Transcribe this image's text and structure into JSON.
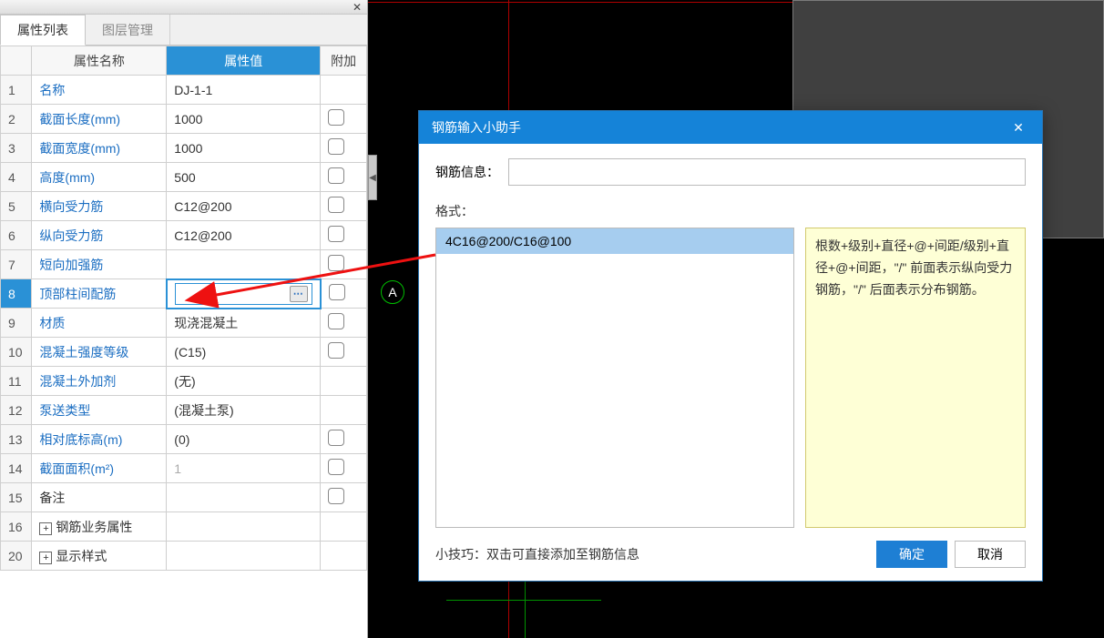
{
  "panel": {
    "tabs": {
      "active": "属性列表",
      "inactive": "图层管理"
    },
    "headers": {
      "name": "属性名称",
      "value": "属性值",
      "extra": "附加"
    },
    "rows": [
      {
        "num": "1",
        "name": "名称",
        "value": "DJ-1-1",
        "extra": false,
        "link": true
      },
      {
        "num": "2",
        "name": "截面长度(mm)",
        "value": "1000",
        "extra": true,
        "link": true
      },
      {
        "num": "3",
        "name": "截面宽度(mm)",
        "value": "1000",
        "extra": true,
        "link": true
      },
      {
        "num": "4",
        "name": "高度(mm)",
        "value": "500",
        "extra": true,
        "link": true
      },
      {
        "num": "5",
        "name": "横向受力筋",
        "value": "C12@200",
        "extra": true,
        "link": true
      },
      {
        "num": "6",
        "name": "纵向受力筋",
        "value": "C12@200",
        "extra": true,
        "link": true
      },
      {
        "num": "7",
        "name": "短向加强筋",
        "value": "",
        "extra": true,
        "link": true
      },
      {
        "num": "8",
        "name": "顶部柱间配筋",
        "value": "",
        "extra": true,
        "link": true,
        "selected": true
      },
      {
        "num": "9",
        "name": "材质",
        "value": "现浇混凝土",
        "extra": true,
        "link": true
      },
      {
        "num": "10",
        "name": "混凝土强度等级",
        "value": "(C15)",
        "extra": true,
        "link": true
      },
      {
        "num": "11",
        "name": "混凝土外加剂",
        "value": "(无)",
        "extra": false,
        "link": true
      },
      {
        "num": "12",
        "name": "泵送类型",
        "value": "(混凝土泵)",
        "extra": false,
        "link": true
      },
      {
        "num": "13",
        "name": "相对底标高(m)",
        "value": "(0)",
        "extra": true,
        "link": true
      },
      {
        "num": "14",
        "name": "截面面积(m²)",
        "value": "1",
        "extra": true,
        "link": true,
        "gray": true
      },
      {
        "num": "15",
        "name": "备注",
        "value": "",
        "extra": true,
        "link": false
      },
      {
        "num": "16",
        "name": "钢筋业务属性",
        "value": "",
        "extra": false,
        "link": false,
        "toggle": true
      },
      {
        "num": "20",
        "name": "显示样式",
        "value": "",
        "extra": false,
        "link": false,
        "toggle": true
      }
    ]
  },
  "dialog": {
    "title": "钢筋输入小助手",
    "info_label": "钢筋信息：",
    "info_value": "",
    "format_label": "格式：",
    "format_items": [
      "4C16@200/C16@100"
    ],
    "description": "根数+级别+直径+@+间距/级别+直径+@+间距，\"/\" 前面表示纵向受力钢筋，\"/\" 后面表示分布钢筋。",
    "tip": "小技巧：双击可直接添加至钢筋信息",
    "ok": "确定",
    "cancel": "取消"
  },
  "marker_label": "A"
}
